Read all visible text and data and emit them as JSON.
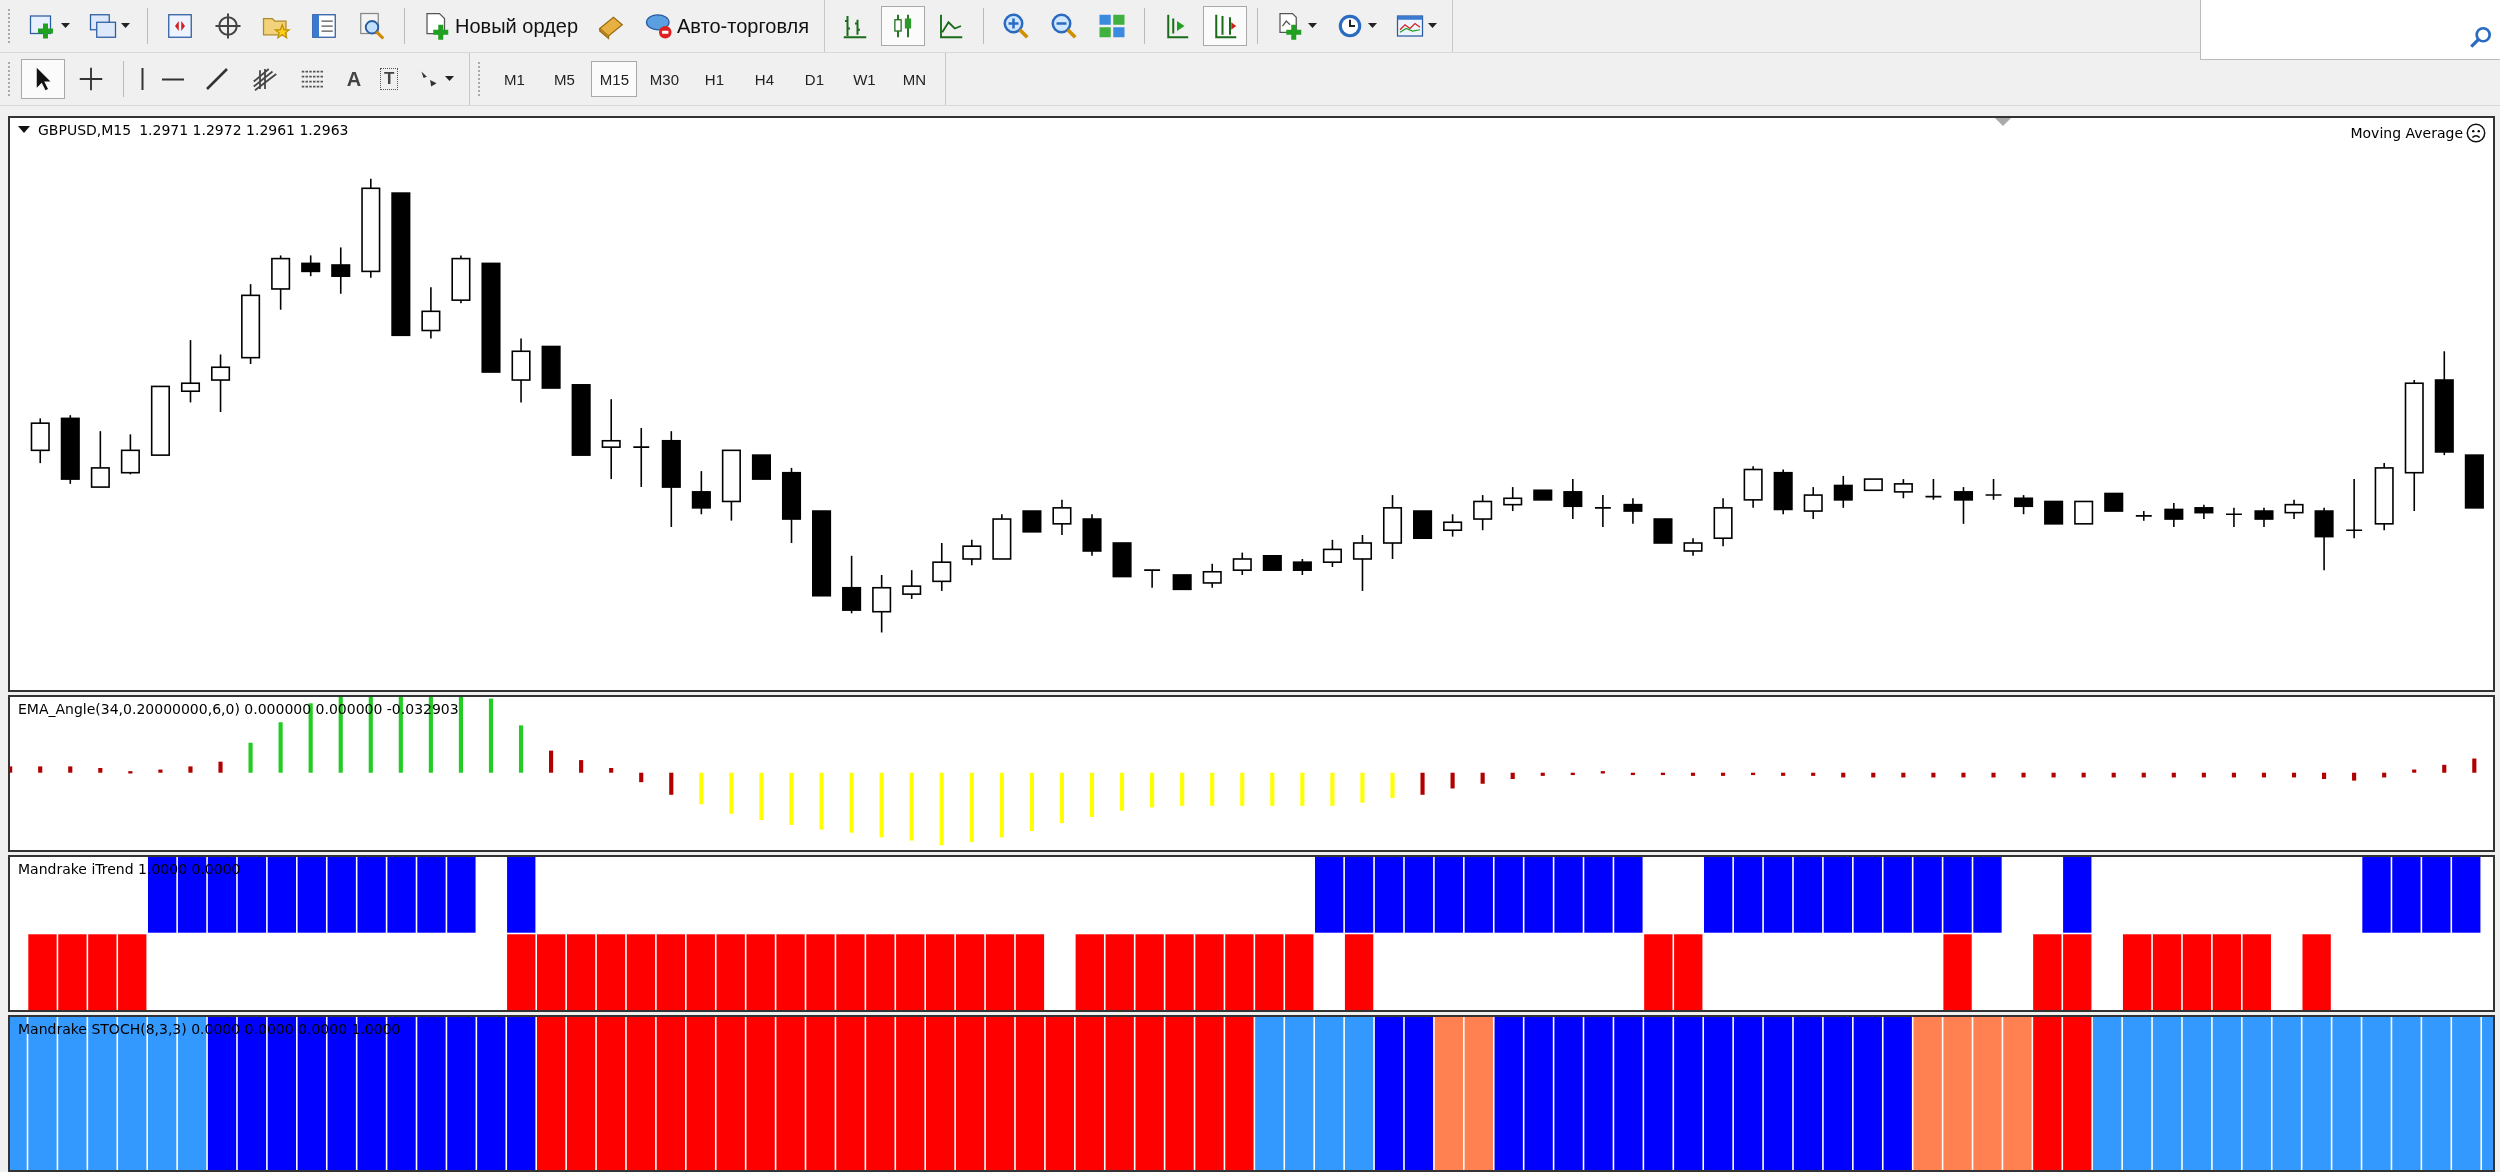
{
  "toolbar": {
    "new_order": {
      "label": "Новый ордер"
    },
    "auto_trading": {
      "label": "Авто-торговля"
    },
    "chart_types": [
      {
        "selected": false
      },
      {
        "selected": true
      },
      {
        "selected": false
      }
    ],
    "autoscroll": {
      "on": false
    },
    "chart_shift": {
      "on": true
    }
  },
  "drawing_tools": [
    {
      "kind": "cursor",
      "selected": true
    },
    {
      "kind": "crosshair",
      "selected": false
    },
    {
      "kind": "vline",
      "selected": false
    },
    {
      "kind": "hline",
      "selected": false
    },
    {
      "kind": "trend",
      "selected": false
    },
    {
      "kind": "fan",
      "selected": false
    },
    {
      "kind": "fibo",
      "selected": false
    },
    {
      "kind": "text",
      "glyph": "A",
      "selected": false
    },
    {
      "kind": "label",
      "glyph": "T",
      "selected": false
    },
    {
      "kind": "arrows",
      "selected": false
    }
  ],
  "timeframes": [
    {
      "label": "M1",
      "selected": false
    },
    {
      "label": "M5",
      "selected": false
    },
    {
      "label": "M15",
      "selected": true
    },
    {
      "label": "M30",
      "selected": false
    },
    {
      "label": "H1",
      "selected": false
    },
    {
      "label": "H4",
      "selected": false
    },
    {
      "label": "D1",
      "selected": false
    },
    {
      "label": "W1",
      "selected": false
    },
    {
      "label": "MN",
      "selected": false
    }
  ],
  "chart": {
    "symbol": "GBPUSD,M15",
    "quotes": "1.2971 1.2972 1.2961 1.2963",
    "expert": "Moving Average"
  },
  "indicators": [
    {
      "kind": "ema_angle",
      "label": "EMA_Angle(34,0.20000000,6,0) 0.000000 0.000000 -0.032903"
    },
    {
      "kind": "itrend",
      "label": "Mandrake iTrend 1.0000 0.0000"
    },
    {
      "kind": "stoch",
      "label": "Mandrake STOCH(8,3,3) 0.0000 0.0000 0.0000 1.0000"
    }
  ]
}
